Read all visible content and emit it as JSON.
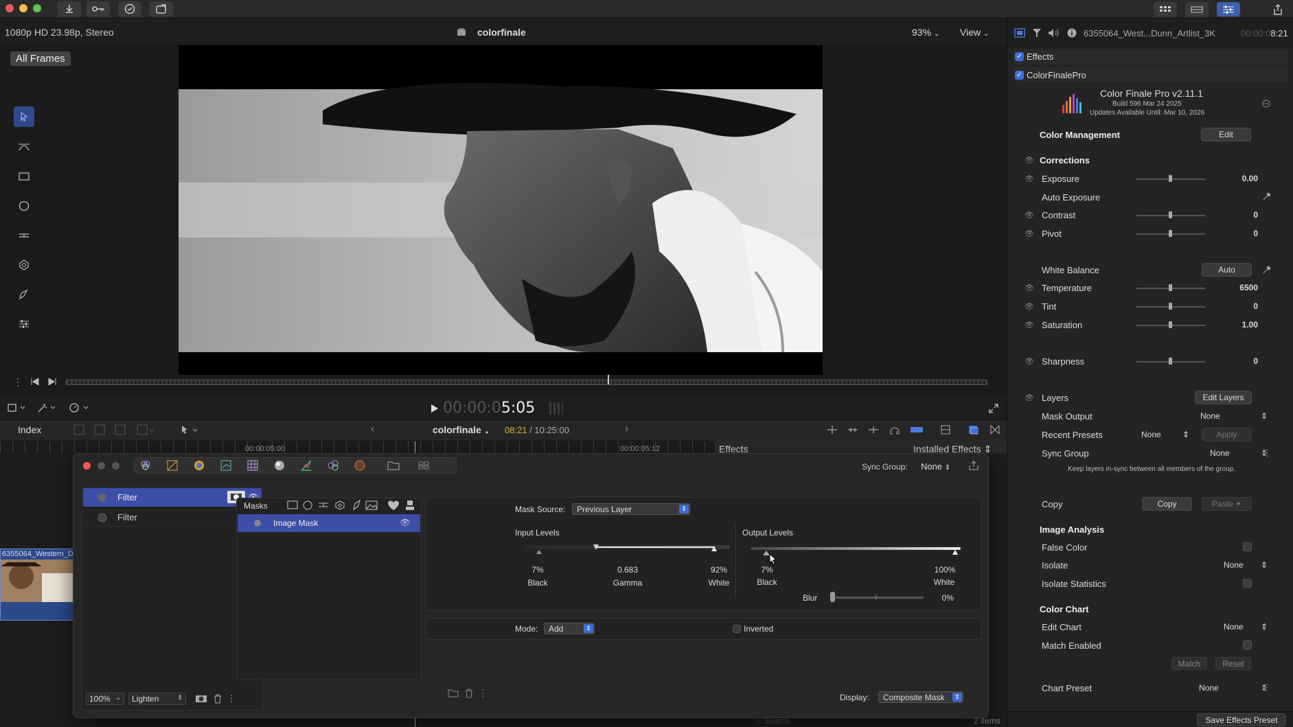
{
  "topbar": {
    "format": "1080p HD 23.98p, Stereo",
    "project": "colorfinale",
    "zoom": "93%",
    "view": "View"
  },
  "viewer": {
    "all_frames": "All Frames",
    "timecode": "00:00:05:05",
    "tc_dim": "00:00:0",
    "tc_bright": "5:05"
  },
  "timeline": {
    "index": "Index",
    "project": "colorfinale",
    "time_current": "08:21",
    "time_total": " / 10:25:00",
    "tick1": "00:00:05:00",
    "tick2": "00:00:05:12",
    "effects": "Effects",
    "installed": "Installed Effects",
    "clip_name": "6355064_Western_D",
    "search": "Search",
    "items": "2 items"
  },
  "cf": {
    "sync_group_label": "Sync Group:",
    "sync_group_value": "None",
    "layers": [
      {
        "name": "Filter"
      },
      {
        "name": "Filter"
      }
    ],
    "opacity": "100%",
    "blend": "Lighten",
    "masks_title": "Masks",
    "mask_item": "Image Mask",
    "mask_source_label": "Mask Source:",
    "mask_source_value": "Previous Layer",
    "input_levels": "Input Levels",
    "output_levels": "Output Levels",
    "in_black": "7%",
    "in_gamma": "0.683",
    "in_white": "92%",
    "in_black_lbl": "Black",
    "in_gamma_lbl": "Gamma",
    "in_white_lbl": "White",
    "out_black": "7%",
    "out_white": "100%",
    "out_black_lbl": "Black",
    "out_white_lbl": "White",
    "blur_label": "Blur",
    "blur_value": "0%",
    "mode_label": "Mode:",
    "mode_value": "Add",
    "inverted": "Inverted",
    "display_label": "Display:",
    "display_value": "Composite Mask"
  },
  "inspector": {
    "clip": "6355064_West...Dunn_Artlist_3K",
    "clip_time_dim": "00:00:0",
    "clip_time": "8:21",
    "effects": "Effects",
    "plugin": "ColorFinalePro",
    "product": "Color Finale Pro v2.11.1",
    "build": "Build 596 Mar 24 2025",
    "updates": "Updates Available Until: Mar 10, 2026",
    "color_mgmt": "Color Management",
    "edit": "Edit",
    "corrections": "Corrections",
    "exposure": "Exposure",
    "exposure_v": "0.00",
    "auto_exposure": "Auto Exposure",
    "contrast": "Contrast",
    "contrast_v": "0",
    "pivot": "Pivot",
    "pivot_v": "0",
    "white_balance": "White Balance",
    "auto": "Auto",
    "temperature": "Temperature",
    "temperature_v": "6500",
    "tint": "Tint",
    "tint_v": "0",
    "saturation": "Saturation",
    "saturation_v": "1.00",
    "sharpness": "Sharpness",
    "sharpness_v": "0",
    "layers": "Layers",
    "edit_layers": "Edit Layers",
    "mask_output": "Mask Output",
    "mask_output_v": "None",
    "recent_presets": "Recent Presets",
    "recent_presets_v": "None",
    "apply": "Apply",
    "sync_group": "Sync Group",
    "sync_group_v": "None",
    "sync_note": "Keep layers in-sync between all members of the group.",
    "copy_label": "Copy",
    "copy_btn": "Copy",
    "paste_btn": "Paste",
    "image_analysis": "Image Analysis",
    "false_color": "False Color",
    "isolate": "Isolate",
    "isolate_v": "None",
    "isolate_stats": "Isolate Statistics",
    "color_chart": "Color Chart",
    "edit_chart": "Edit Chart",
    "edit_chart_v": "None",
    "match_enabled": "Match Enabled",
    "match": "Match",
    "reset": "Reset",
    "chart_preset": "Chart Preset",
    "chart_preset_v": "None",
    "save_preset": "Save Effects Preset"
  },
  "colors": {
    "accent": "#3d6fd6",
    "panel": "#242424",
    "selected_row": "#3c4ea8"
  }
}
